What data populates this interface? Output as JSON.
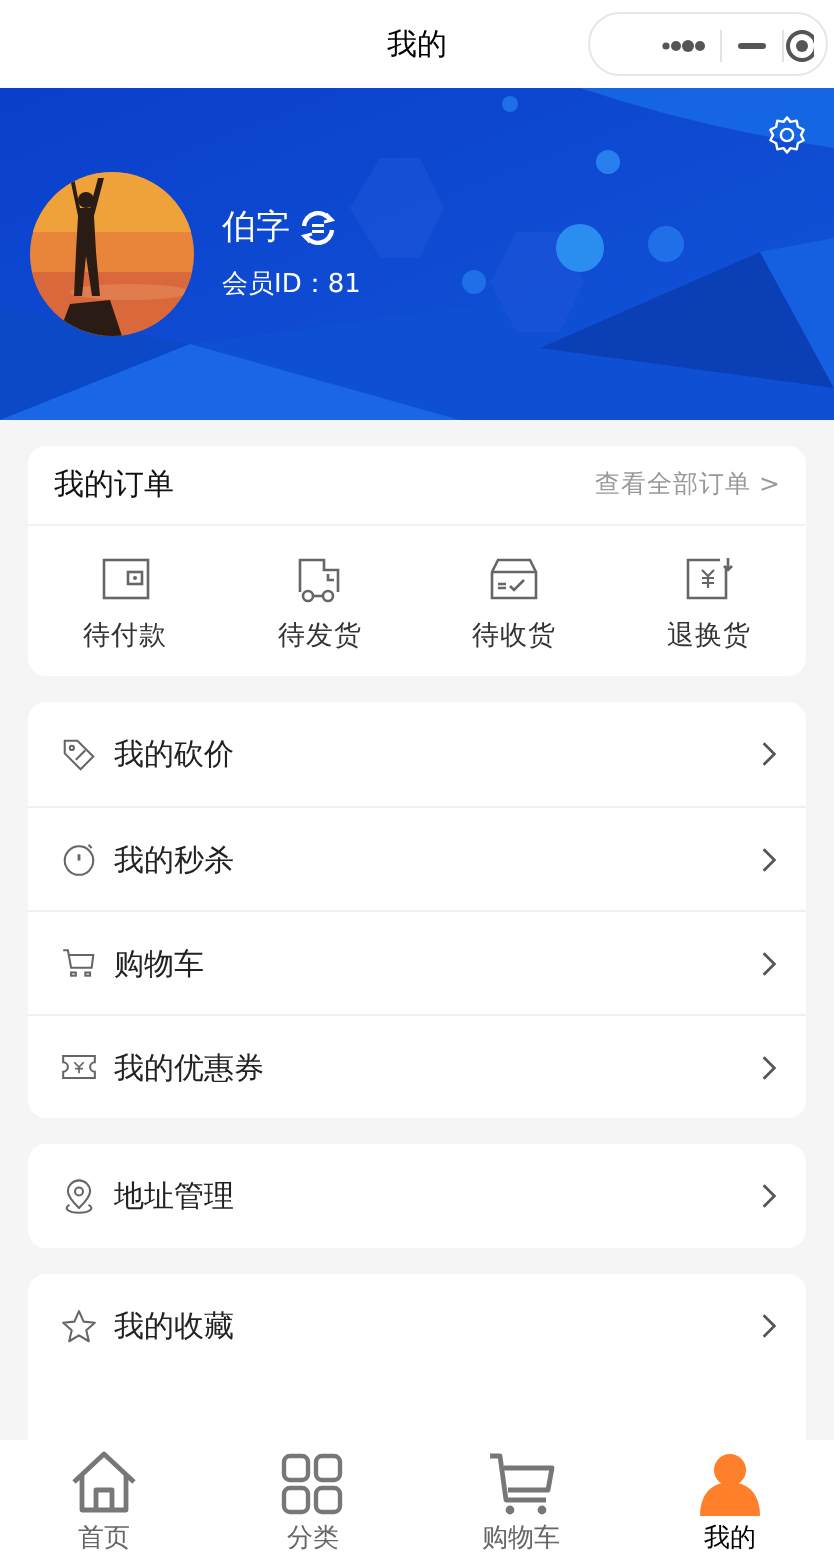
{
  "nav_bar": {
    "title": "我的"
  },
  "profile": {
    "name": "伯字",
    "member_id": "会员ID：81"
  },
  "orders": {
    "title": "我的订单",
    "view_all": "查看全部订单",
    "view_all_arrow": ">",
    "items": [
      {
        "label": "待付款"
      },
      {
        "label": "待发货"
      },
      {
        "label": "待收货"
      },
      {
        "label": "退换货"
      }
    ]
  },
  "menu_groups": [
    {
      "items": [
        {
          "label": "我的砍价"
        },
        {
          "label": "我的秒杀"
        },
        {
          "label": "购物车"
        },
        {
          "label": "我的优惠券"
        }
      ]
    },
    {
      "items": [
        {
          "label": "地址管理"
        }
      ]
    },
    {
      "items": [
        {
          "label": "我的收藏"
        }
      ]
    }
  ],
  "tab_bar": {
    "items": [
      {
        "label": "首页",
        "selected": false
      },
      {
        "label": "分类",
        "selected": false
      },
      {
        "label": "购物车",
        "selected": false
      },
      {
        "label": "我的",
        "selected": true
      }
    ]
  }
}
